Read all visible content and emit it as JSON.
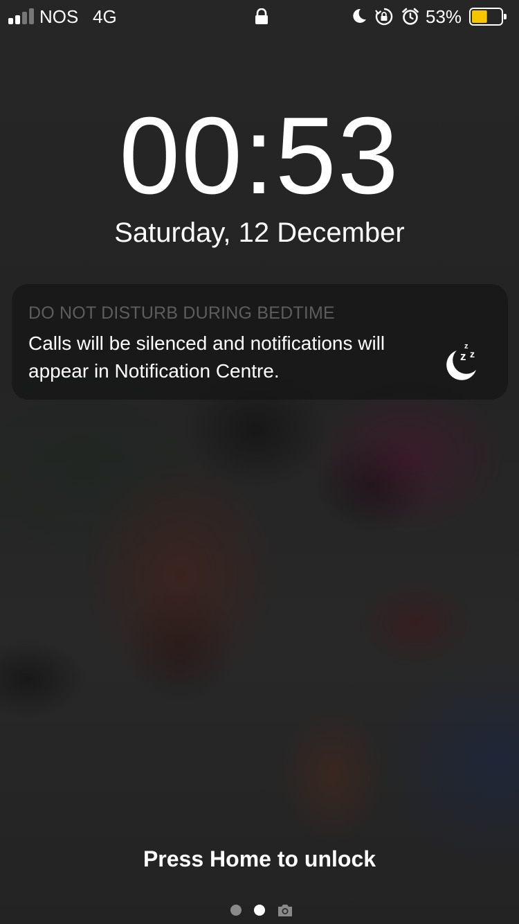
{
  "status_bar": {
    "carrier": "NOS",
    "network": "4G",
    "battery_percent": "53%",
    "battery_level": 0.53,
    "battery_color": "#f5c500",
    "signal_bars": 2,
    "icons": [
      "lock-icon",
      "do-not-disturb-moon-icon",
      "orientation-lock-icon",
      "alarm-icon",
      "battery-icon"
    ]
  },
  "lock_screen": {
    "time": "00:53",
    "date": "Saturday, 12 December"
  },
  "notification": {
    "header": "DO NOT DISTURB DURING BEDTIME",
    "body": "Calls will be silenced and notifications will appear in Notification Centre.",
    "icon": "bedtime-moon-zzz-icon"
  },
  "bottom": {
    "unlock_hint": "Press Home to unlock",
    "pages": 2,
    "current_page": 2,
    "extra_page_icon": "camera-icon"
  }
}
